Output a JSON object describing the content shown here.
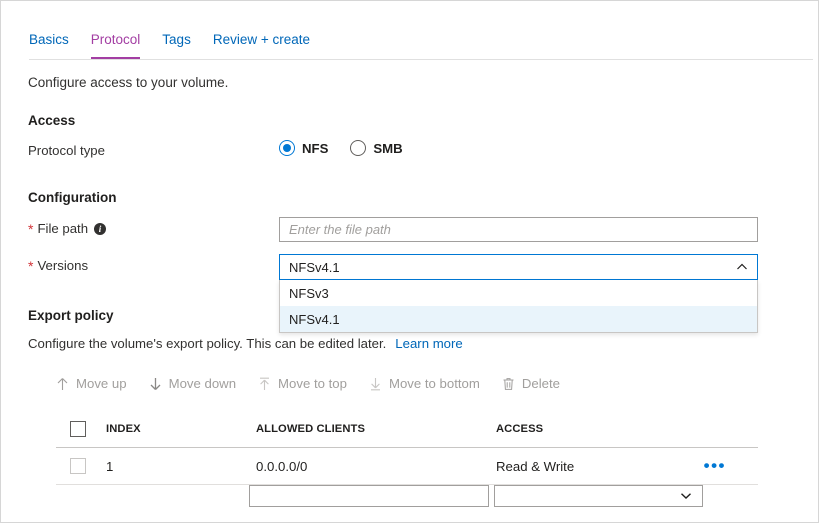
{
  "tabs": [
    {
      "label": "Basics",
      "active": false
    },
    {
      "label": "Protocol",
      "active": true
    },
    {
      "label": "Tags",
      "active": false
    },
    {
      "label": "Review + create",
      "active": false
    }
  ],
  "intro": "Configure access to your volume.",
  "access": {
    "heading": "Access",
    "protocol_type_label": "Protocol type",
    "options": [
      {
        "label": "NFS",
        "checked": true
      },
      {
        "label": "SMB",
        "checked": false
      }
    ]
  },
  "configuration": {
    "heading": "Configuration",
    "file_path": {
      "label": "File path",
      "required": "*",
      "info": "i",
      "value": "",
      "placeholder": "Enter the file path"
    },
    "versions": {
      "label": "Versions",
      "required": "*",
      "value": "NFSv4.1",
      "expanded": true,
      "options": [
        {
          "label": "NFSv3",
          "selected": false
        },
        {
          "label": "NFSv4.1",
          "selected": true
        }
      ]
    }
  },
  "export_policy": {
    "heading": "Export policy",
    "description": "Configure the volume's export policy. This can be edited later.",
    "learn_more": "Learn more",
    "commands": [
      {
        "label": "Move up",
        "icon": "arrow-up-icon"
      },
      {
        "label": "Move down",
        "icon": "arrow-down-icon"
      },
      {
        "label": "Move to top",
        "icon": "arrow-to-top-icon"
      },
      {
        "label": "Move to bottom",
        "icon": "arrow-to-bottom-icon"
      },
      {
        "label": "Delete",
        "icon": "trash-icon"
      }
    ],
    "table": {
      "columns": [
        "INDEX",
        "ALLOWED CLIENTS",
        "ACCESS"
      ],
      "rows": [
        {
          "index": "1",
          "allowed_clients": "0.0.0.0/0",
          "access": "Read & Write",
          "menu": "•••"
        }
      ],
      "new_row": {
        "client_value": "",
        "client_placeholder": "",
        "access_value": ""
      }
    }
  },
  "colors": {
    "link": "#0067b8",
    "active_tab": "#a33ea3",
    "accent": "#0078d4",
    "required": "#d13438",
    "selected_row": "#e9f4fb"
  }
}
